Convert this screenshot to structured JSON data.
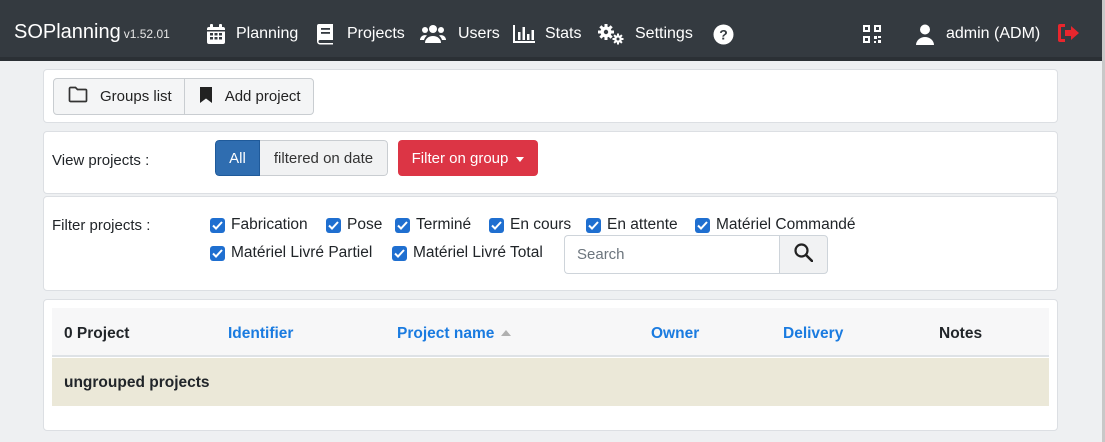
{
  "navbar": {
    "brand": "SOPlanning",
    "version": "v1.52.01",
    "items": [
      {
        "label": "Planning",
        "icon": "calendar-icon"
      },
      {
        "label": "Projects",
        "icon": "book-icon"
      },
      {
        "label": "Users",
        "icon": "users-icon"
      },
      {
        "label": "Stats",
        "icon": "bar-chart-icon"
      },
      {
        "label": "Settings",
        "icon": "gears-icon"
      }
    ],
    "help_icon": "question-circle-icon",
    "qr_icon": "qrcode-icon",
    "user": {
      "label": "admin (ADM)",
      "icon": "user-icon"
    },
    "logout_icon": "sign-out-icon",
    "logout_color": "#e8262d"
  },
  "toolbar": {
    "groups_list": "Groups list",
    "add_project": "Add project"
  },
  "view": {
    "label": "View projects :",
    "all": "All",
    "filtered_on_date": "filtered on date",
    "filter_on_group": "Filter on group",
    "active_color": "#2f6db0",
    "danger_color": "#dc3545"
  },
  "filter": {
    "label": "Filter projects :",
    "statuses": [
      {
        "label": "Fabrication",
        "checked": true
      },
      {
        "label": "Pose",
        "checked": true
      },
      {
        "label": "Terminé",
        "checked": true
      },
      {
        "label": "En cours",
        "checked": true
      },
      {
        "label": "En attente",
        "checked": true
      },
      {
        "label": "Matériel Commandé",
        "checked": true
      },
      {
        "label": "Matériel Livré Partiel",
        "checked": true
      },
      {
        "label": "Matériel Livré Total",
        "checked": true
      }
    ],
    "search_placeholder": "Search",
    "search_value": ""
  },
  "table": {
    "count": "0 Project",
    "columns": [
      "Identifier",
      "Project name",
      "Owner",
      "Delivery",
      "Notes"
    ],
    "sort_column": "Project name",
    "sort_direction": "ascending",
    "link_color": "#1a7be0",
    "group_label": "ungrouped projects",
    "group_row_color": "#ebe8d8"
  }
}
